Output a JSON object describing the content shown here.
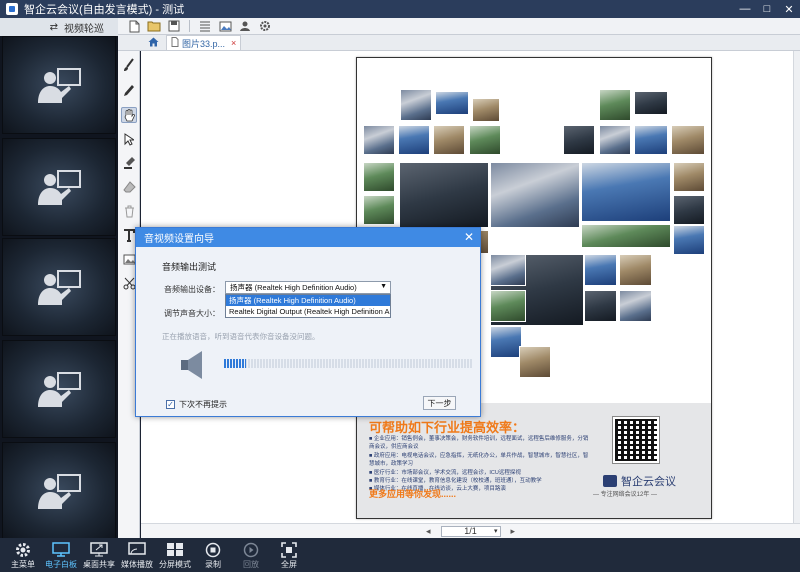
{
  "window": {
    "title": "智企云会议(自由发言模式) - 测试",
    "controls": [
      "—",
      "□",
      "✕"
    ]
  },
  "video_panel": {
    "header_label": "视频轮巡",
    "tile_count": 5
  },
  "tabs": {
    "doc_tab_label": "图片33.p...",
    "close": "×"
  },
  "document": {
    "headline": "可帮助如下行业提高效率：",
    "bullets": [
      "企业应用：销售例会，董事决策会，财务软件培训，远程面试，远程售后维修服务，分销商会议，供应商会议",
      "政府应用：电视电话会议，应急指挥，无纸化办公，单兵作战，智慧城市，智慧社区，智慧城市，政策学习",
      "医疗行业：市场部会议，学术交流，远程会诊，ICU远程探视",
      "教育行业：在线课堂，教育信息化建设（校校通，班班通），互动教学",
      "媒体行业：在线直播，在线访谈，云上大赛，项目路演"
    ],
    "more": "更多应用等你发现......",
    "brand": "智企云会议",
    "slogan": "— 专注网络会议12年 —"
  },
  "pagination": {
    "prev": "◂",
    "page": "1/1",
    "next": "▸"
  },
  "dialog": {
    "title": "音视频设置向导",
    "close": "✕",
    "section_title": "音频输出测试",
    "output_label": "音频输出设备：",
    "volume_label": "调节声音大小：",
    "selected_device": "扬声器 (Realtek High Definition Audio)",
    "options": [
      "扬声器 (Realtek High Definition Audio)",
      "Realtek Digital Output (Realtek High Definition Audio)"
    ],
    "hint": "正在播放语音，听到语音代表你音设备没问题。",
    "meter_level": 0.09,
    "checkbox_label": "下次不再提示",
    "checkbox_checked": true,
    "next_button": "下一步"
  },
  "bottom_bar": [
    {
      "label": "主菜单",
      "icon": "gear-icon",
      "active": false,
      "disabled": false
    },
    {
      "label": "电子白板",
      "icon": "whiteboard-icon",
      "active": true,
      "disabled": false
    },
    {
      "label": "桌面共享",
      "icon": "desktop-share-icon",
      "active": false,
      "disabled": false
    },
    {
      "label": "媒体播放",
      "icon": "media-play-icon",
      "active": false,
      "disabled": false
    },
    {
      "label": "分屏模式",
      "icon": "split-screen-icon",
      "active": false,
      "disabled": false
    },
    {
      "label": "录制",
      "icon": "record-icon",
      "active": false,
      "disabled": false
    },
    {
      "label": "回放",
      "icon": "playback-icon",
      "active": false,
      "disabled": true
    },
    {
      "label": "全屏",
      "icon": "fullscreen-icon",
      "active": false,
      "disabled": false
    }
  ],
  "colors": {
    "accent": "#3f8ae4",
    "active_tab_text": "#5ec4ff",
    "headline": "#f07a1a",
    "brand_blue": "#2b3f73"
  }
}
